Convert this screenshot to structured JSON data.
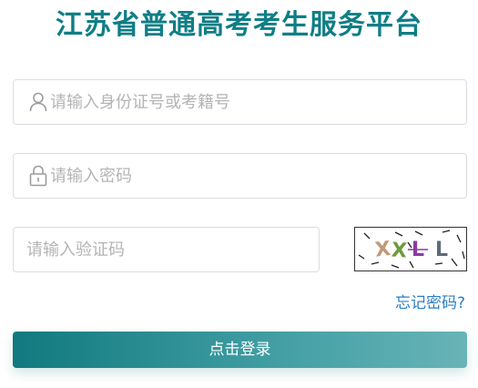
{
  "header": {
    "title": "江苏省普通高考考生服务平台"
  },
  "form": {
    "id_field": {
      "placeholder": "请输入身份证号或考籍号",
      "value": "",
      "icon": "user-icon"
    },
    "password_field": {
      "placeholder": "请输入密码",
      "value": "",
      "icon": "lock-icon"
    },
    "captcha_field": {
      "placeholder": "请输入验证码",
      "value": ""
    },
    "captcha_image": {
      "chars": [
        {
          "char": "X",
          "color": "#c29a78"
        },
        {
          "char": "X",
          "color": "#6f9a3e"
        },
        {
          "char": "L",
          "color": "#8a3aa0"
        },
        {
          "char": "L",
          "color": "#5d6a7a"
        }
      ]
    },
    "forgot_password_label": "忘记密码?",
    "login_button_label": "点击登录"
  },
  "colors": {
    "brand": "#0e7e86",
    "link": "#2b7fc4",
    "button_gradient_start": "#11797f",
    "button_gradient_end": "#68b4b7",
    "input_border": "#d9dde3",
    "placeholder": "#b4b4b4"
  }
}
